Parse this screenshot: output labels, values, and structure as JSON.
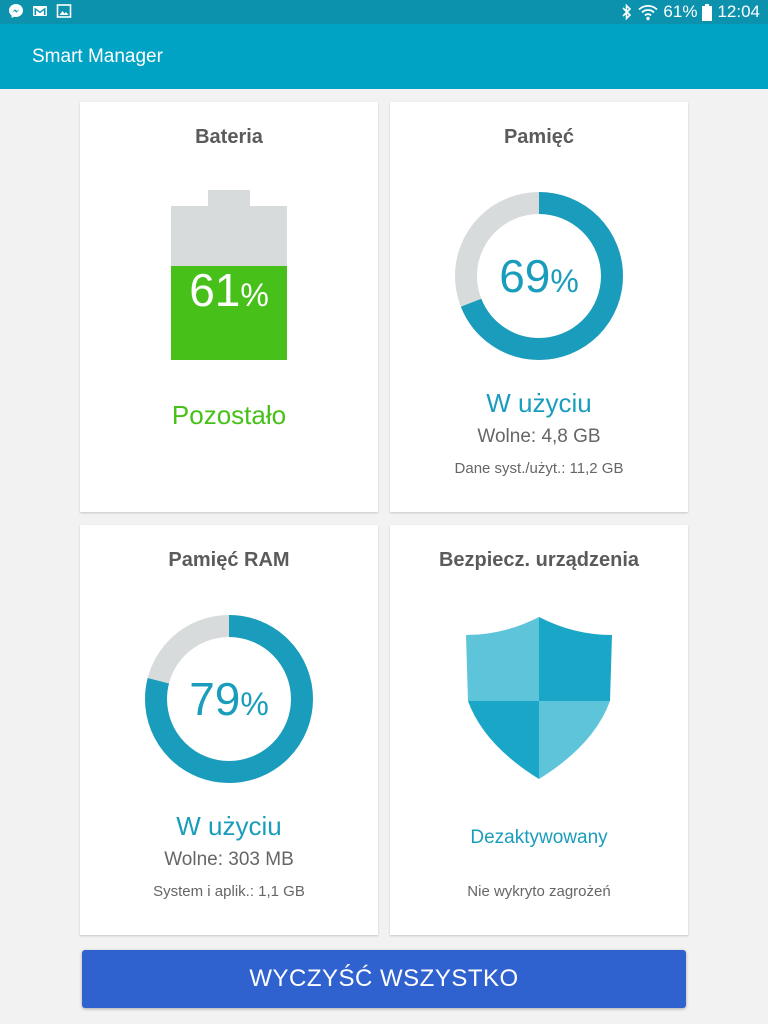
{
  "status_bar": {
    "left_icons": [
      "messenger-icon",
      "gmail-icon",
      "gallery-icon"
    ],
    "battery_text": "61%",
    "time": "12:04"
  },
  "app": {
    "title": "Smart Manager"
  },
  "battery": {
    "title": "Bateria",
    "percent_value": "61",
    "percent_unit": "%",
    "level": 0.61,
    "status": "Pozostało",
    "color": "#47c119"
  },
  "storage": {
    "title": "Pamięć",
    "percent_value": "69",
    "percent_unit": "%",
    "used_fraction": 0.69,
    "status": "W użyciu",
    "free": "Wolne: 4,8 GB",
    "detail": "Dane syst./użyt.: 11,2 GB"
  },
  "ram": {
    "title": "Pamięć RAM",
    "percent_value": "79",
    "percent_unit": "%",
    "used_fraction": 0.79,
    "status": "W użyciu",
    "free": "Wolne: 303 MB",
    "detail": "System i aplik.: 1,1 GB"
  },
  "security": {
    "title": "Bezpiecz. urządzenia",
    "status": "Dezaktywowany",
    "detail": "Nie wykryto zagrożeń",
    "icon": "shield-icon"
  },
  "clean_button": {
    "label": "WYCZYŚĆ WSZYSTKO"
  },
  "colors": {
    "status_bar": "#0c92ad",
    "app_bar": "#00a3c4",
    "accent": "#1a9dbc",
    "ring_track": "#d7dbdb",
    "button": "#2f61cf"
  }
}
